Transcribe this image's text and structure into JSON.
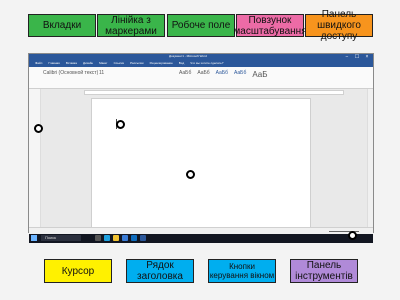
{
  "labels": {
    "tabs": "Вкладки",
    "ruler": "Лінійка з маркерами",
    "workspace": "Робоче поле",
    "zoom": "Повзунок масштабування",
    "qat": "Панель швидкого доступу",
    "cursor": "Курсор",
    "titlebar": "Рядок заголовка",
    "window_buttons": "Кнопки керування вікном",
    "toolbar": "Панель інструментів"
  },
  "colors": {
    "green": "#3ab54a",
    "orange": "#f7941d",
    "pink": "#ec6ba6",
    "yellow": "#fff100",
    "cyan": "#00aeef",
    "purple": "#b08ad8",
    "word_blue": "#2b579a"
  },
  "word": {
    "title": "Документ1 - Microsoft Word",
    "tabs": [
      "Файл",
      "Главная",
      "Вставка",
      "Дизайн",
      "Макет",
      "Ссылки",
      "Рассылки",
      "Рецензирование",
      "Вид"
    ],
    "tell_me": "Что вы хотите сделать?",
    "font_name": "Calibri (Основной текст)",
    "font_size": "11",
    "style_sample": "АаБб",
    "style_sample_big": "АаБ",
    "search_box": "Поиск",
    "controls": [
      "−",
      "☐",
      "×"
    ]
  }
}
